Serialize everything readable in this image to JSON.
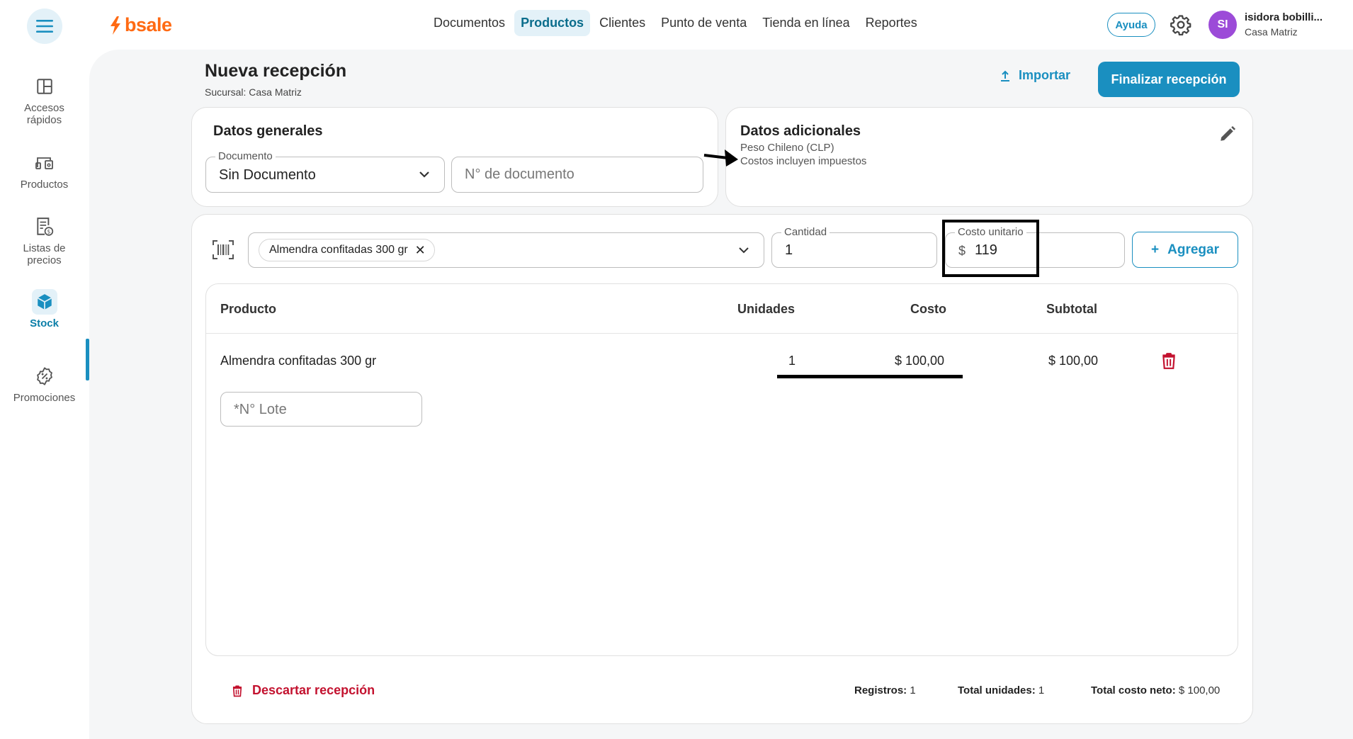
{
  "brand": {
    "name": "bsale",
    "color": "#ff6a13"
  },
  "accent": "#1a8fc0",
  "danger": "#c3122f",
  "icons": {
    "menu": "hamburger-icon",
    "settings": "gear-icon",
    "import": "upload-icon",
    "edit": "pencil-icon",
    "barcode": "barcode-icon",
    "delete": "trash-icon"
  },
  "nav": [
    {
      "label": "Documentos"
    },
    {
      "label": "Productos"
    },
    {
      "label": "Clientes"
    },
    {
      "label": "Punto de venta"
    },
    {
      "label": "Tienda en línea"
    },
    {
      "label": "Reportes"
    }
  ],
  "header": {
    "help_label": "Ayuda",
    "user": {
      "initials": "SI",
      "name": "isidora bobilli...",
      "branch": "Casa Matriz"
    }
  },
  "sidebar": {
    "items": [
      {
        "label_1": "Accesos",
        "label_2": "rápidos"
      },
      {
        "label_1": "Productos"
      },
      {
        "label_1": "Listas de",
        "label_2": "precios"
      },
      {
        "label_1": "Stock"
      },
      {
        "label_1": "Promociones"
      }
    ]
  },
  "page": {
    "title": "Nueva recepción",
    "subtitle": "Sucursal: Casa Matriz",
    "import_label": "Importar",
    "finish_label": "Finalizar recepción"
  },
  "general": {
    "title": "Datos generales",
    "document_legend": "Documento",
    "document_value": "Sin Documento",
    "doc_number_placeholder": "N° de documento"
  },
  "additional": {
    "title": "Datos adicionales",
    "currency": "Peso Chileno (CLP)",
    "tax_note": "Costos incluyen impuestos"
  },
  "entry": {
    "product_chip": "Almendra confitadas 300 gr",
    "chip_remove": "✕",
    "quantity_legend": "Cantidad",
    "quantity_value": "1",
    "unit_cost_legend": "Costo unitario",
    "currency_symbol": "$",
    "unit_cost_value": "119",
    "add_plus": "+",
    "add_label": "Agregar"
  },
  "table": {
    "headers": {
      "product": "Producto",
      "units": "Unidades",
      "cost": "Costo",
      "subtotal": "Subtotal"
    },
    "rows": [
      {
        "product": "Almendra confitadas 300 gr",
        "units": "1",
        "cost": "$ 100,00",
        "subtotal": "$ 100,00",
        "lot_placeholder": "*N° Lote"
      }
    ]
  },
  "footer": {
    "discard_label": "Descartar recepción",
    "records_label": "Registros:",
    "records_value": "1",
    "units_label": "Total unidades:",
    "units_value": "1",
    "net_label": "Total costo neto:",
    "net_value": "$ 100,00"
  }
}
